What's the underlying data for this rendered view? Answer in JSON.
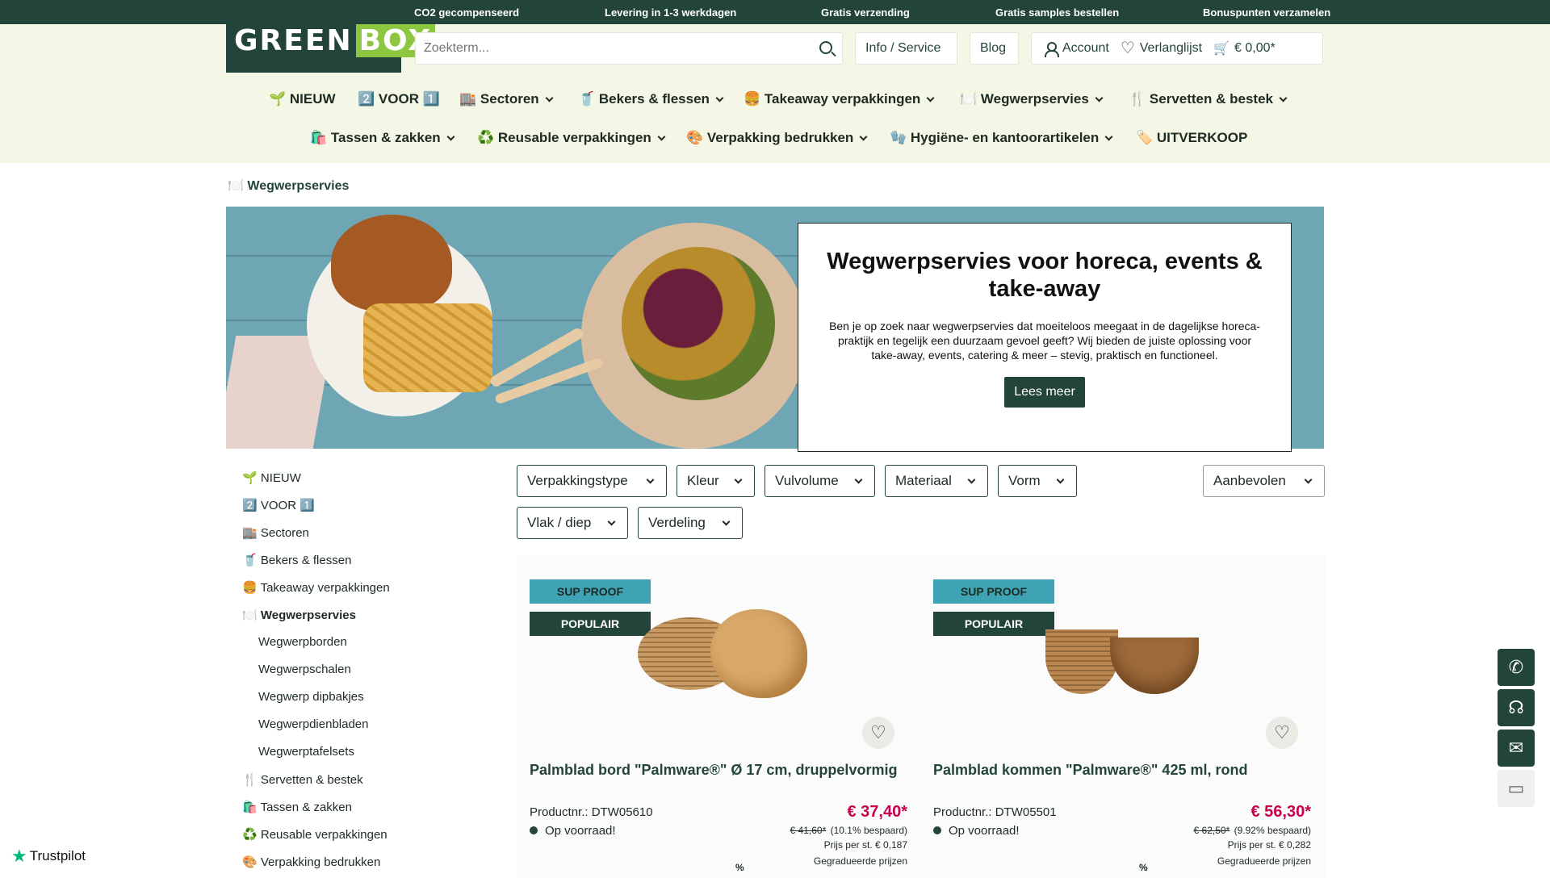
{
  "topbar": [
    "CO2 gecompenseerd",
    "Levering in 1-3 werkdagen",
    "Gratis verzending",
    "Gratis samples bestellen",
    "Bonuspunten verzamelen"
  ],
  "logo": {
    "text": "GREEN",
    "box": "BOX"
  },
  "search": {
    "placeholder": "Zoekterm..."
  },
  "header": {
    "info": "Info / Service",
    "blog": "Blog",
    "account": "Account",
    "wishlist": "Verlanglijst",
    "cart": "€ 0,00*"
  },
  "nav_row1": [
    {
      "emoji": "🌱",
      "label": "NIEUW",
      "dropdown": false
    },
    {
      "emoji": "2️⃣",
      "label": "VOOR",
      "suffix": "1️⃣",
      "dropdown": false
    },
    {
      "emoji": "🏬",
      "label": "Sectoren",
      "dropdown": true
    },
    {
      "emoji": "🥤",
      "label": "Bekers & flessen",
      "dropdown": true
    },
    {
      "emoji": "🍔",
      "label": "Takeaway verpakkingen",
      "dropdown": true
    },
    {
      "emoji": "🍽️",
      "label": "Wegwerpservies",
      "dropdown": true
    },
    {
      "emoji": "🍴",
      "label": "Servetten & bestek",
      "dropdown": true
    }
  ],
  "nav_row2": [
    {
      "emoji": "🛍️",
      "label": "Tassen & zakken",
      "dropdown": true
    },
    {
      "emoji": "♻️",
      "label": "Reusable verpakkingen",
      "dropdown": true
    },
    {
      "emoji": "🎨",
      "label": "Verpakking bedrukken",
      "dropdown": true
    },
    {
      "emoji": "🧤",
      "label": "Hygiëne- en kantoorartikelen",
      "dropdown": true
    },
    {
      "emoji": "🏷️",
      "label": "UITVERKOOP",
      "dropdown": false
    }
  ],
  "breadcrumb": {
    "emoji": "🍽️",
    "label": "Wegwerpservies"
  },
  "hero": {
    "title": "Wegwerpservies voor horeca, events & take-away",
    "text": "Ben je op zoek naar wegwerpservies dat moeiteloos meegaat in de dagelijkse horeca-praktijk en tegelijk een duurzaam gevoel geeft? Wij bieden de juiste oplossing voor take-away, events, catering & meer – stevig, praktisch en functioneel.",
    "button": "Lees meer"
  },
  "sidebar": [
    {
      "emoji": "🌱",
      "label": "NIEUW"
    },
    {
      "emoji": "2️⃣",
      "label": "VOOR 1️⃣"
    },
    {
      "emoji": "🏬",
      "label": "Sectoren"
    },
    {
      "emoji": "🥤",
      "label": "Bekers & flessen"
    },
    {
      "emoji": "🍔",
      "label": "Takeaway verpakkingen"
    },
    {
      "emoji": "🍽️",
      "label": "Wegwerpservies"
    },
    {
      "emoji": "",
      "label": "Wegwerpborden"
    },
    {
      "emoji": "",
      "label": "Wegwerpschalen"
    },
    {
      "emoji": "",
      "label": "Wegwerp dipbakjes"
    },
    {
      "emoji": "",
      "label": "Wegwerpdienbladen"
    },
    {
      "emoji": "",
      "label": "Wegwerptafelsets"
    },
    {
      "emoji": "🍴",
      "label": "Servetten & bestek"
    },
    {
      "emoji": "🛍️",
      "label": "Tassen & zakken"
    },
    {
      "emoji": "♻️",
      "label": "Reusable verpakkingen"
    },
    {
      "emoji": "🎨",
      "label": "Verpakking bedrukken"
    }
  ],
  "filters": [
    "Verpakkingstype",
    "Kleur",
    "Vulvolume",
    "Materiaal",
    "Vorm",
    "Vlak / diep",
    "Verdeling"
  ],
  "sort": "Aanbevolen",
  "products": [
    {
      "badge1": "SUP PROOF",
      "badge2": "POPULAIR",
      "name": "Palmblad bord \"Palmware®\" Ø 17 cm, druppelvormig",
      "productnr": "Productnr.: DTW05610",
      "stock": "Op voorraad!",
      "price": "€ 37,40*",
      "old_price": "€ 41,60*",
      "saving": "(10.1% bespaard)",
      "per_unit": "Prijs per st. € 0,187",
      "graduated": "Gegradueerde prijzen",
      "pct": "%"
    },
    {
      "badge1": "SUP PROOF",
      "badge2": "POPULAIR",
      "name": "Palmblad kommen \"Palmware®\" 425 ml, rond",
      "productnr": "Productnr.: DTW05501",
      "stock": "Op voorraad!",
      "price": "€ 56,30*",
      "old_price": "€ 62,50*",
      "saving": "(9.92% bespaard)",
      "per_unit": "Prijs per st. € 0,282",
      "graduated": "Gegradueerde prijzen",
      "pct": "%"
    }
  ],
  "trustpilot": "Trustpilot",
  "colors": {
    "brand": "#23443a",
    "accent": "#8dc63f",
    "price": "#c8004e",
    "sup": "#3ea3b5",
    "header_bg": "#f5f7e6"
  }
}
